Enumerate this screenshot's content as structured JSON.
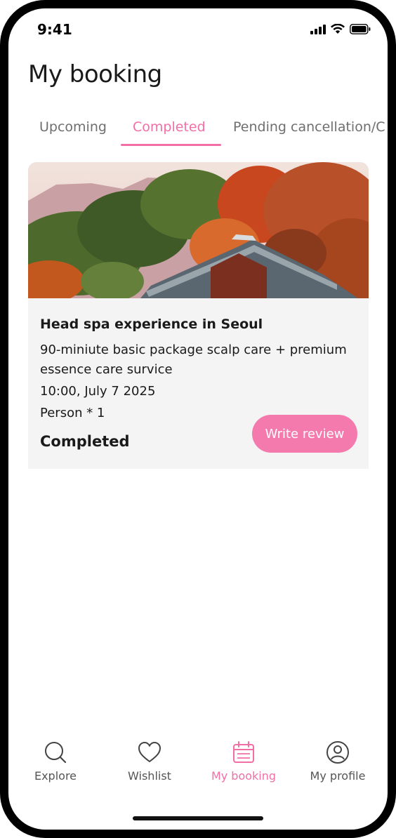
{
  "status_bar": {
    "time": "9:41"
  },
  "header": {
    "title": "My booking"
  },
  "tabs": [
    {
      "label": "Upcoming",
      "active": false
    },
    {
      "label": "Completed",
      "active": true
    },
    {
      "label": "Pending cancellation/C",
      "active": false
    }
  ],
  "booking": {
    "title": "Head spa experience in Seoul",
    "description": "90-miniute basic package scalp care + premium essence care survice",
    "datetime": "10:00, July 7 2025",
    "person": "Person * 1",
    "status": "Completed",
    "action_label": "Write review"
  },
  "bottom_nav": [
    {
      "label": "Explore",
      "icon": "search-icon",
      "active": false
    },
    {
      "label": "Wishlist",
      "icon": "heart-icon",
      "active": false
    },
    {
      "label": "My booking",
      "icon": "calendar-icon",
      "active": true
    },
    {
      "label": "My profile",
      "icon": "user-circle-icon",
      "active": false
    }
  ],
  "colors": {
    "accent": "#f26fa6",
    "button": "#f47aae",
    "card_bg": "#f4f4f4"
  }
}
